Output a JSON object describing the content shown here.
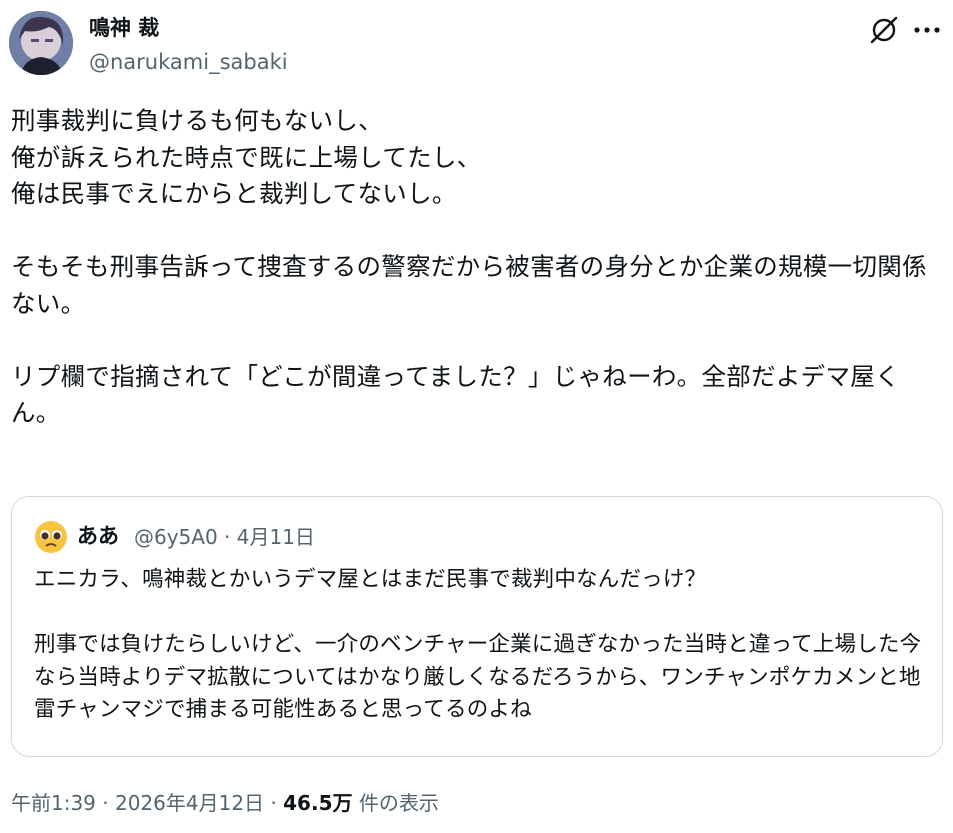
{
  "author": {
    "display_name": "鳴神 裁",
    "handle": "@narukami_sabaki"
  },
  "icons": {
    "avatar": "profile-avatar",
    "grok": "grok-icon",
    "more": "more-icon",
    "quote_avatar": "pleading-face-emoji"
  },
  "tweet": {
    "text": "刑事裁判に負けるも何もないし、\n俺が訴えられた時点で既に上場してたし、\n俺は民事でえにからと裁判してないし。\n\nそもそも刑事告訴って捜査するの警察だから被害者の身分とか企業の規模一切関係ない。\n\nリプ欄で指摘されて「どこが間違ってました？」じゃねーわ。全部だよデマ屋くん。"
  },
  "quote": {
    "name": "ああ",
    "handle_date": "@6y5A0 · 4月11日",
    "text": "エニカラ、鳴神裁とかいうデマ屋とはまだ民事で裁判中なんだっけ？\n\n刑事では負けたらしいけど、一介のベンチャー企業に過ぎなかった当時と違って上場した今なら当時よりデマ拡散についてはかなり厳しくなるだろうから、ワンチャンポケカメンと地雷チャンマジで捕まる可能性あると思ってるのよね"
  },
  "meta": {
    "time": "午前1:39 · 2026年4月12日 · ",
    "views_count": "46.5万",
    "views_label": " 件の表示"
  }
}
